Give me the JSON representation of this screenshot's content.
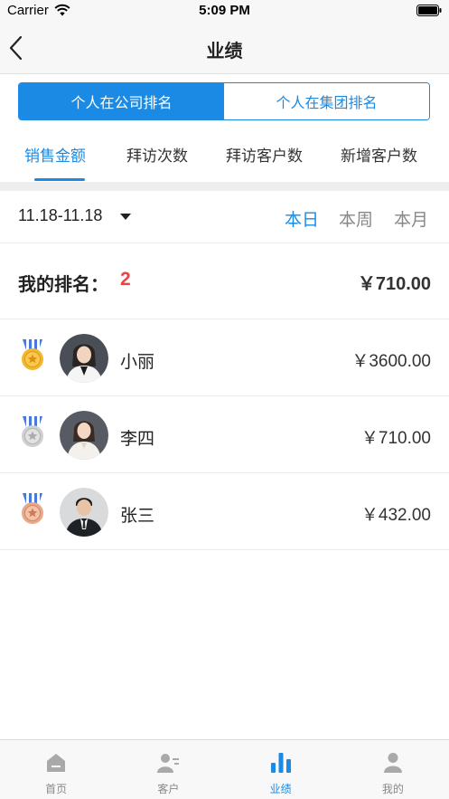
{
  "status_bar": {
    "carrier": "Carrier",
    "time": "5:09 PM"
  },
  "nav": {
    "title": "业绩"
  },
  "segment": {
    "options": [
      "个人在公司排名",
      "个人在集团排名"
    ],
    "selected": "个人在公司排名"
  },
  "category_tabs": {
    "items": [
      "销售金额",
      "拜访次数",
      "拜访客户数",
      "新增客户数"
    ],
    "selected": "销售金额"
  },
  "filter": {
    "date_range": "11.18-11.18",
    "periods": [
      "本日",
      "本周",
      "本月"
    ],
    "selected_period": "本日"
  },
  "my_rank": {
    "label": "我的排名：",
    "value": "2",
    "amount": "￥710.00"
  },
  "ranking": [
    {
      "name": "小丽",
      "amount": "￥3600.00",
      "medal": "gold-medal-icon"
    },
    {
      "name": "李四",
      "amount": "￥710.00",
      "medal": "silver-medal-icon"
    },
    {
      "name": "张三",
      "amount": "￥432.00",
      "medal": "bronze-medal-icon"
    }
  ],
  "tab_bar": {
    "items": [
      {
        "label": "首页",
        "icon": "home-icon"
      },
      {
        "label": "客户",
        "icon": "customer-icon"
      },
      {
        "label": "业绩",
        "icon": "performance-chart-icon"
      },
      {
        "label": "我的",
        "icon": "profile-icon"
      }
    ],
    "selected": "业绩"
  },
  "colors": {
    "accent": "#1a8ae5",
    "rank_highlight": "#e64545",
    "gold": "#f2b731",
    "silver": "#cfcfcf",
    "bronze": "#e8a889"
  }
}
